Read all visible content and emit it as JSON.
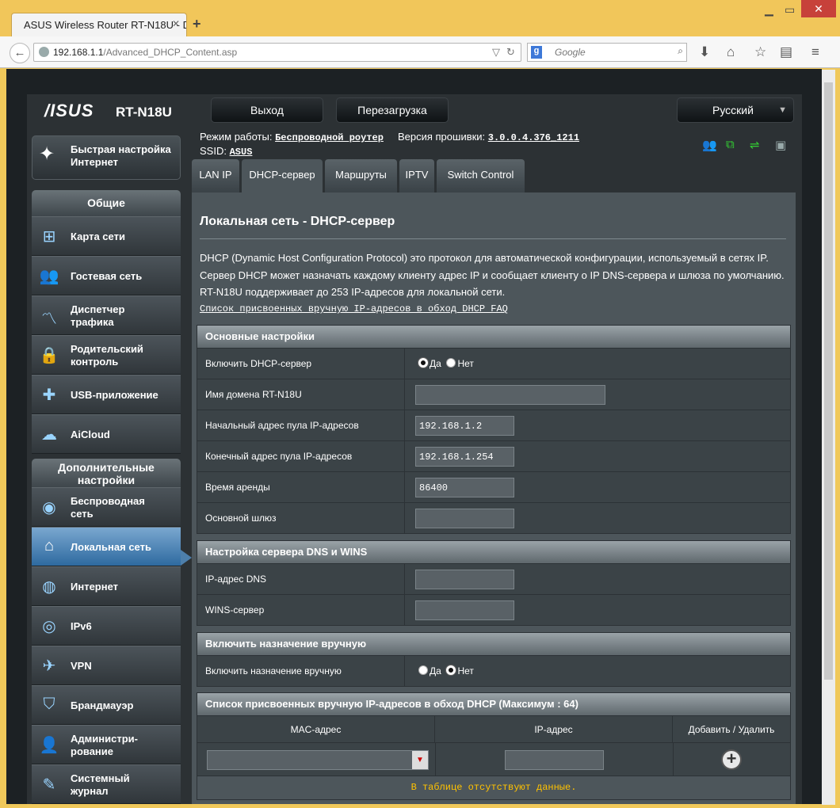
{
  "browser": {
    "tab_title": "ASUS Wireless Router RT-N18U - D...",
    "new_tab": "+",
    "url_host": "192.168.1.1",
    "url_path": "/Advanced_DHCP_Content.asp",
    "search_placeholder": "Google",
    "search_engine_letter": "g"
  },
  "header": {
    "logo": "/ISUS",
    "model": "RT-N18U",
    "logout_label": "Выход",
    "reboot_label": "Перезагрузка",
    "language": "Русский",
    "mode_label": "Режим работы:",
    "mode_value": "Беспроводной роутер",
    "firmware_label": "Версия прошивки:",
    "firmware_value": "3.0.0.4.376_1211",
    "ssid_label": "SSID:",
    "ssid_value": "ASUS"
  },
  "sidebar": {
    "quick_setup": [
      "Быстрая настройка",
      "Интернет"
    ],
    "general_title": "Общие",
    "general_items": [
      {
        "label": "Карта сети",
        "icon": "network-map-icon"
      },
      {
        "label": "Гостевая сеть",
        "icon": "guest-network-icon"
      },
      {
        "label": "Диспетчер трафика",
        "icon": "traffic-manager-icon"
      },
      {
        "label": "Родительский контроль",
        "icon": "parental-control-icon"
      },
      {
        "label": "USB-приложение",
        "icon": "usb-app-icon"
      },
      {
        "label": "AiCloud",
        "icon": "aicloud-icon"
      }
    ],
    "advanced_title": "Дополнительные настройки",
    "advanced_items": [
      {
        "label": "Беспроводная сеть",
        "icon": "wireless-icon"
      },
      {
        "label": "Локальная сеть",
        "icon": "lan-home-icon",
        "active": true
      },
      {
        "label": "Интернет",
        "icon": "globe-icon"
      },
      {
        "label": "IPv6",
        "icon": "ipv6-icon"
      },
      {
        "label": "VPN",
        "icon": "vpn-icon"
      },
      {
        "label": "Брандмауэр",
        "icon": "firewall-shield-icon"
      },
      {
        "label": "Администри- рование",
        "icon": "admin-user-icon"
      },
      {
        "label": "Системный журнал",
        "icon": "syslog-icon"
      }
    ]
  },
  "tabs": [
    "LAN IP",
    "DHCP-сервер",
    "Маршруты",
    "IPTV",
    "Switch Control"
  ],
  "active_tab": "DHCP-сервер",
  "main": {
    "title": "Локальная сеть - DHCP-сервер",
    "description": "DHCP (Dynamic Host Configuration Protocol) это протокол для автоматической конфигурации, используемый в сетях IP. Сервер DHCP может назначать каждому клиенту адрес IP и сообщает клиенту о IP DNS-сервера и шлюза по умолчанию. RT-N18U поддерживает до 253 IP-адресов для локальной сети.",
    "faq_link": "Список присвоенных вручную IP-адресов в обход DHCP FAQ",
    "basic": {
      "title": "Основные настройки",
      "enable_label": "Включить DHCP-сервер",
      "yes": "Да",
      "no": "Нет",
      "domain_label": "Имя домена RT-N18U",
      "domain_value": "",
      "start_label": "Начальный адрес пула IP-адресов",
      "start_value": "192.168.1.2",
      "end_label": "Конечный адрес пула IP-адресов",
      "end_value": "192.168.1.254",
      "lease_label": "Время аренды",
      "lease_value": "86400",
      "gateway_label": "Основной шлюз",
      "gateway_value": ""
    },
    "dns": {
      "title": "Настройка сервера DNS и WINS",
      "dns_label": "IP-адрес DNS",
      "dns_value": "",
      "wins_label": "WINS-сервер",
      "wins_value": ""
    },
    "manual": {
      "title": "Включить назначение вручную",
      "label": "Включить назначение вручную",
      "yes": "Да",
      "no": "Нет"
    },
    "list": {
      "title": "Список присвоенных вручную IP-адресов в обход DHCP (Максимум : 64)",
      "col_mac": "MAC-адрес",
      "col_ip": "IP-адрес",
      "col_action": "Добавить / Удалить",
      "empty": "В таблице отсутствуют данные."
    }
  }
}
